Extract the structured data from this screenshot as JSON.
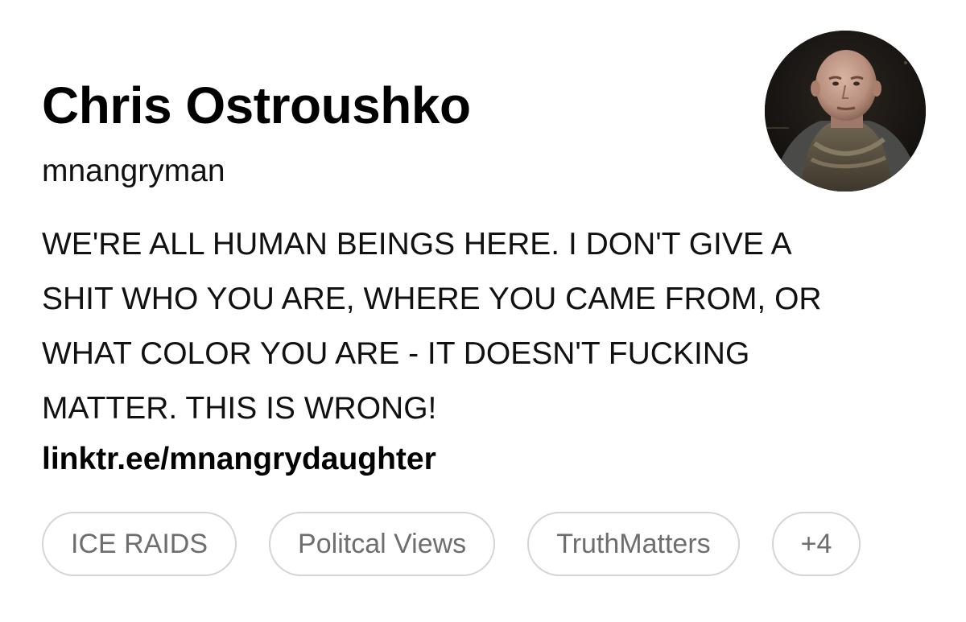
{
  "profile": {
    "display_name": "Chris Ostroushko",
    "username": "mnangryman",
    "bio_lines": [
      "WE'RE ALL HUMAN BEINGS HERE. I DON'T GIVE A",
      "SHIT WHO YOU ARE, WHERE YOU CAME FROM, OR",
      "WHAT COLOR YOU ARE - IT DOESN'T FUCKING",
      "MATTER. THIS IS WRONG!"
    ],
    "link": "linktr.ee/mnangrydaughter",
    "avatar_icon": "profile-photo"
  },
  "tags": [
    "ICE RAIDS",
    "Politcal Views",
    "TruthMatters"
  ],
  "more_tags_label": "+4",
  "colors": {
    "text": "#000000",
    "tag_text": "#6e6e6e",
    "tag_border": "#d4d4d4",
    "background": "#ffffff"
  }
}
